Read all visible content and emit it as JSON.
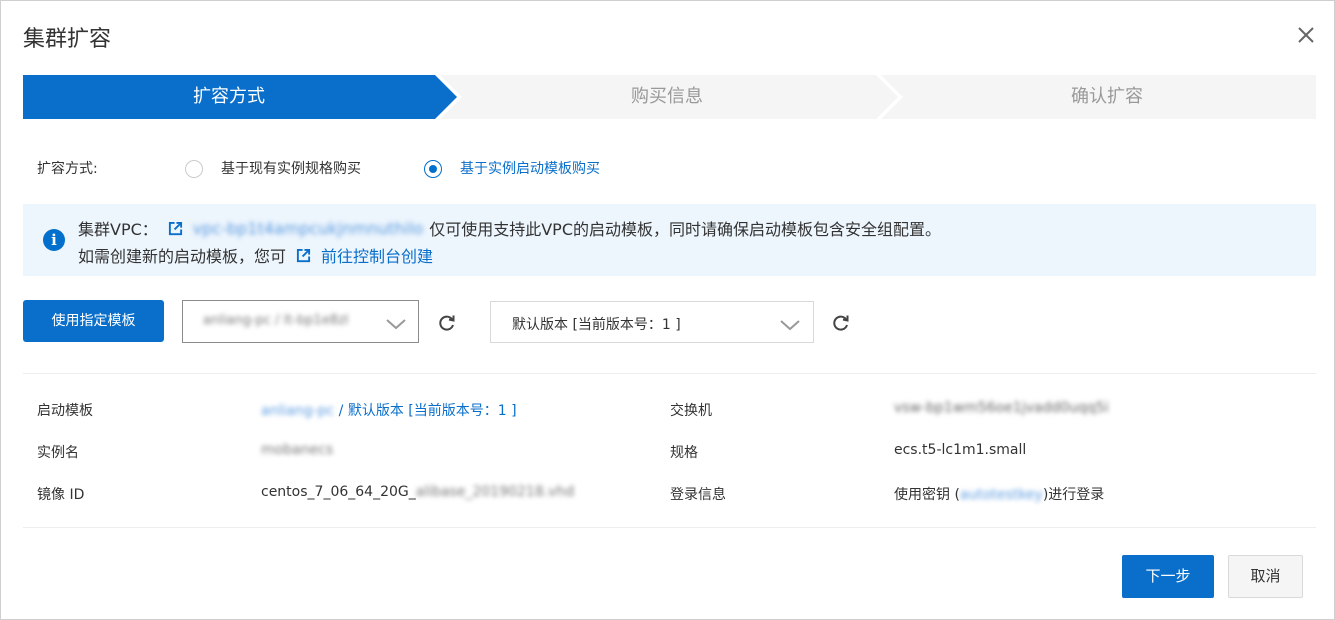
{
  "dialog": {
    "title": "集群扩容",
    "close_icon": "close-icon"
  },
  "steps": [
    {
      "label": "扩容方式",
      "active": true
    },
    {
      "label": "购买信息",
      "active": false
    },
    {
      "label": "确认扩容",
      "active": false
    }
  ],
  "mode": {
    "label": "扩容方式:",
    "options": [
      {
        "label": "基于现有实例规格购买",
        "selected": false
      },
      {
        "label": "基于实例启动模板购买",
        "selected": true
      }
    ]
  },
  "notice": {
    "line1_prefix": "集群VPC：",
    "vpc_id": "vpc-bp1t4ampcukjnmnuthilo",
    "line1_suffix": "仅可使用支持此VPC的启动模板，同时请确保启动模板包含安全组配置。",
    "line2_prefix": "如需创建新的启动模板，您可",
    "line2_link": "前往控制台创建"
  },
  "template": {
    "button_label": "使用指定模板",
    "template_select_value": "anliang-pc / lt-bp1e8zl",
    "version_select_value": "默认版本 [当前版本号：1 ]"
  },
  "details": {
    "launch_template_label": "启动模板",
    "launch_template_name": "anliang-pc",
    "launch_template_version": " / 默认版本 [当前版本号：1 ]",
    "instance_name_label": "实例名",
    "instance_name_value": "mobanecs",
    "image_id_label": "镜像 ID",
    "image_id_prefix": "centos_7_06_64_20G_",
    "image_id_suffix": "alibase_20190218.vhd",
    "vswitch_label": "交换机",
    "vswitch_value": "vsw-bp1wm56oe1jvadd0uqq5i",
    "spec_label": "规格",
    "spec_value": "ecs.t5-lc1m1.small",
    "login_label": "登录信息",
    "login_prefix": "使用密钥 (",
    "login_key": "autotestkey",
    "login_suffix": ")进行登录"
  },
  "footer": {
    "next_label": "下一步",
    "cancel_label": "取消"
  },
  "colors": {
    "accent": "#0a6fcb",
    "notice_bg": "#edf5fd",
    "step_inactive": "#f5f5f5"
  }
}
